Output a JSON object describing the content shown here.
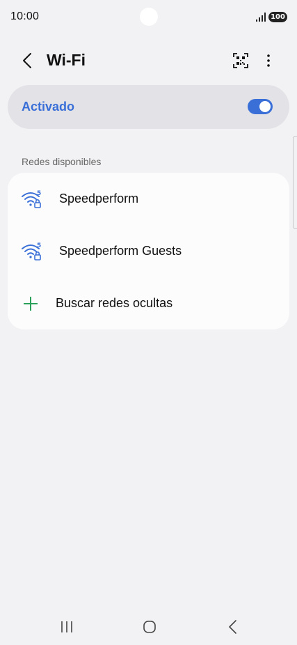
{
  "status_bar": {
    "time": "10:00",
    "battery": "100"
  },
  "header": {
    "title": "Wi-Fi",
    "back_icon": "chevron-left-icon",
    "qr_icon": "qr-code-scan-icon",
    "more_icon": "more-vertical-icon"
  },
  "master_toggle": {
    "label": "Activado",
    "on": true
  },
  "available_networks": {
    "section_label": "Redes disponibles",
    "items": [
      {
        "name": "Speedperform",
        "icon": "wifi-5ghz-lock-icon"
      },
      {
        "name": "Speedperform Guests",
        "icon": "wifi-5ghz-lock-icon"
      }
    ],
    "add_hidden": {
      "label": "Buscar redes ocultas",
      "icon": "plus-icon"
    }
  },
  "colors": {
    "accent": "#3a6fd8",
    "plus": "#2aa05a",
    "background": "#f2f2f4",
    "card": "#fcfcfd",
    "master_card": "#e3e3e7"
  }
}
